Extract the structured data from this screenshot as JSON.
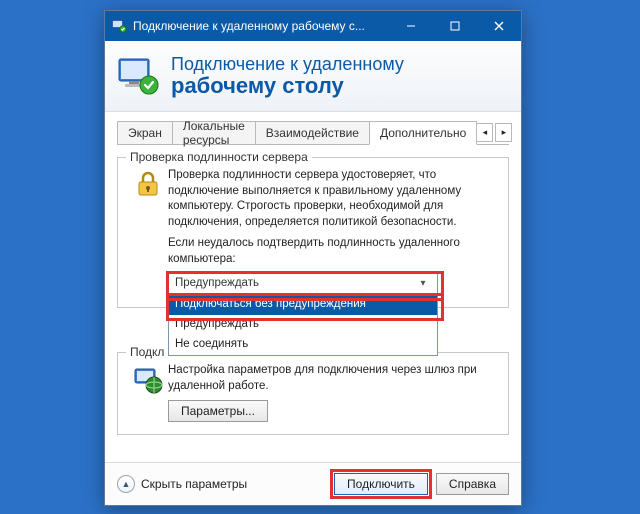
{
  "window": {
    "title": "Подключение к удаленному рабочему с..."
  },
  "banner": {
    "line1": "Подключение к удаленному",
    "line2": "рабочему столу"
  },
  "tabs": {
    "t0": "Экран",
    "t1": "Локальные ресурсы",
    "t2": "Взаимодействие",
    "t3": "Дополнительно"
  },
  "group_auth": {
    "legend": "Проверка подлинности сервера",
    "desc": "Проверка подлинности сервера удостоверяет, что подключение выполняется к правильному удаленному компьютеру. Строгость проверки, необходимой для подключения, определяется политикой безопасности.",
    "prompt": "Если неудалось подтвердить подлинность удаленного компьютера:",
    "combo_value": "Предупреждать",
    "options": {
      "o0": "Подключаться без предупреждения",
      "o1": "Предупреждать",
      "o2": "Не соединять"
    }
  },
  "group_gateway": {
    "legend": "Подкл",
    "desc": "Настройка параметров для подключения через шлюз при удаленной работе.",
    "params_btn": "Параметры..."
  },
  "footer": {
    "hide": "Скрыть параметры",
    "connect": "Подключить",
    "help": "Справка"
  }
}
